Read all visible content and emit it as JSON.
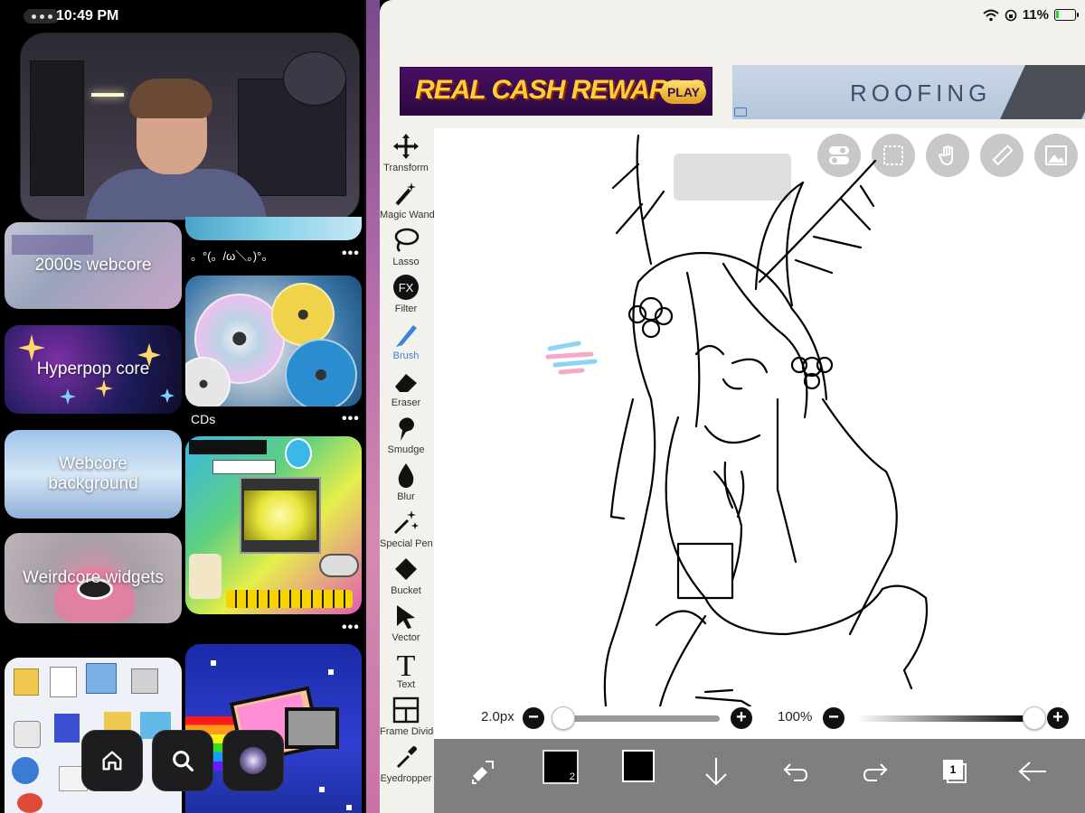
{
  "status_bar": {
    "time": "10:49 PM",
    "battery": "11%"
  },
  "left_app": {
    "tiles": [
      {
        "title": "2000s webcore"
      },
      {
        "caption": "。°(。/ω＼。)°。"
      },
      {
        "title": "Hyperpop core"
      },
      {
        "caption": "CDs"
      },
      {
        "title": "Webcore background"
      },
      {
        "title": "Weirdcore widgets"
      }
    ],
    "more_dots": "•••",
    "nav": [
      "home-icon",
      "search-icon",
      "profile-icon"
    ]
  },
  "ads": {
    "banner1": {
      "text": "REAL CASH REWARDS",
      "button": "PLAY"
    },
    "banner2": {
      "text": "ROOFING"
    }
  },
  "toolbar": {
    "tools": [
      {
        "label": "Transform",
        "icon": "transform-icon"
      },
      {
        "label": "Magic Wand",
        "icon": "magic-wand-icon"
      },
      {
        "label": "Lasso",
        "icon": "lasso-icon"
      },
      {
        "label": "Filter",
        "icon": "fx-filter-icon"
      },
      {
        "label": "Brush",
        "icon": "brush-icon",
        "active": true
      },
      {
        "label": "Eraser",
        "icon": "eraser-icon"
      },
      {
        "label": "Smudge",
        "icon": "smudge-icon"
      },
      {
        "label": "Blur",
        "icon": "blur-icon"
      },
      {
        "label": "Special Pen",
        "icon": "special-pen-icon"
      },
      {
        "label": "Bucket",
        "icon": "bucket-icon"
      },
      {
        "label": "Vector",
        "icon": "vector-icon"
      },
      {
        "label": "Text",
        "icon": "text-icon"
      },
      {
        "label": "Frame Divider",
        "icon": "frame-divider-icon"
      },
      {
        "label": "Eyedropper",
        "icon": "eyedropper-icon"
      }
    ],
    "accent_color": "#3b82e0"
  },
  "canvas": {
    "top_icons": [
      "toggle-icon",
      "selection-icon",
      "hand-icon",
      "ruler-icon",
      "image-icon"
    ],
    "brush_size": "2.0px",
    "brush_opacity": "100%",
    "brush_size_level": 0.03,
    "opacity_level": 1.0
  },
  "bottom_bar": {
    "layer_badge": "2",
    "layer_count": "1",
    "icons": [
      "swap-tool-icon",
      "color-swatch-icon",
      "download-icon",
      "undo-icon",
      "redo-icon",
      "layers-icon",
      "back-arrow-icon"
    ]
  }
}
